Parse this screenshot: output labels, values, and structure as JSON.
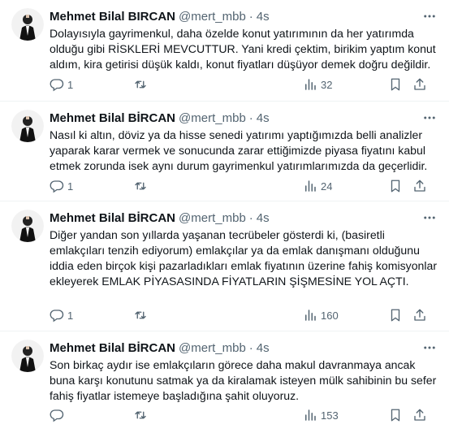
{
  "tweets": [
    {
      "name": "Mehmet Bilal BIRCAN",
      "handle": "@mert_mbb",
      "dot": "·",
      "time": "4s",
      "text": "Dolayısıyla gayrimenkul, daha özelde konut yatırımının da her yatırımda olduğu gibi RİSKLERİ MEVCUTTUR. Yani kredi çektim, birikim yaptım konut aldım, kira getirisi düşük kaldı, konut fiyatları düşüyor demek doğru değildir.",
      "replies": "1",
      "retweets": "",
      "views": "32"
    },
    {
      "name": "Mehmet Bilal BİRCAN",
      "handle": "@mert_mbb",
      "dot": "·",
      "time": "4s",
      "text": "Nasıl ki altın, döviz ya da hisse senedi yatırımı yaptığımızda belli analizler yaparak karar vermek ve sonucunda zarar ettiğimizde piyasa fiyatını kabul etmek zorunda isek aynı durum gayrimenkul yatırımlarımızda da geçerlidir.",
      "replies": "1",
      "retweets": "",
      "views": "24"
    },
    {
      "name": "Mehmet Bilal BİRCAN",
      "handle": "@mert_mbb",
      "dot": "·",
      "time": "4s",
      "text": "Diğer yandan son yıllarda yaşanan tecrübeler gösterdi ki, (basiretli emlakçıları tenzih ediyorum) emlakçılar ya da emlak danışmanı olduğunu iddia eden birçok kişi pazarladıkları emlak fiyatının üzerine fahiş komisyonlar ekleyerek EMLAK PİYASASINDA FİYATLARIN ŞİŞMESİNE YOL AÇTI.",
      "replies": "1",
      "retweets": "",
      "views": "160"
    },
    {
      "name": "Mehmet Bilal BİRCAN",
      "handle": "@mert_mbb",
      "dot": "·",
      "time": "4s",
      "text": "Son birkaç aydır ise emlakçıların görece daha makul davranmaya ancak buna karşı konutunu satmak ya da kiralamak isteyen mülk sahibinin bu sefer fahiş fiyatlar istemeye başladığına şahit oluyoruz.",
      "replies": "",
      "retweets": "",
      "views": "153"
    }
  ],
  "icons": {
    "more": "more-icon",
    "reply": "reply-icon",
    "retweet": "retweet-icon",
    "views": "views-icon",
    "bookmark": "bookmark-icon",
    "share": "share-icon"
  },
  "colors": {
    "text": "#0f1419",
    "secondary": "#536471",
    "divider": "#eff3f4"
  }
}
